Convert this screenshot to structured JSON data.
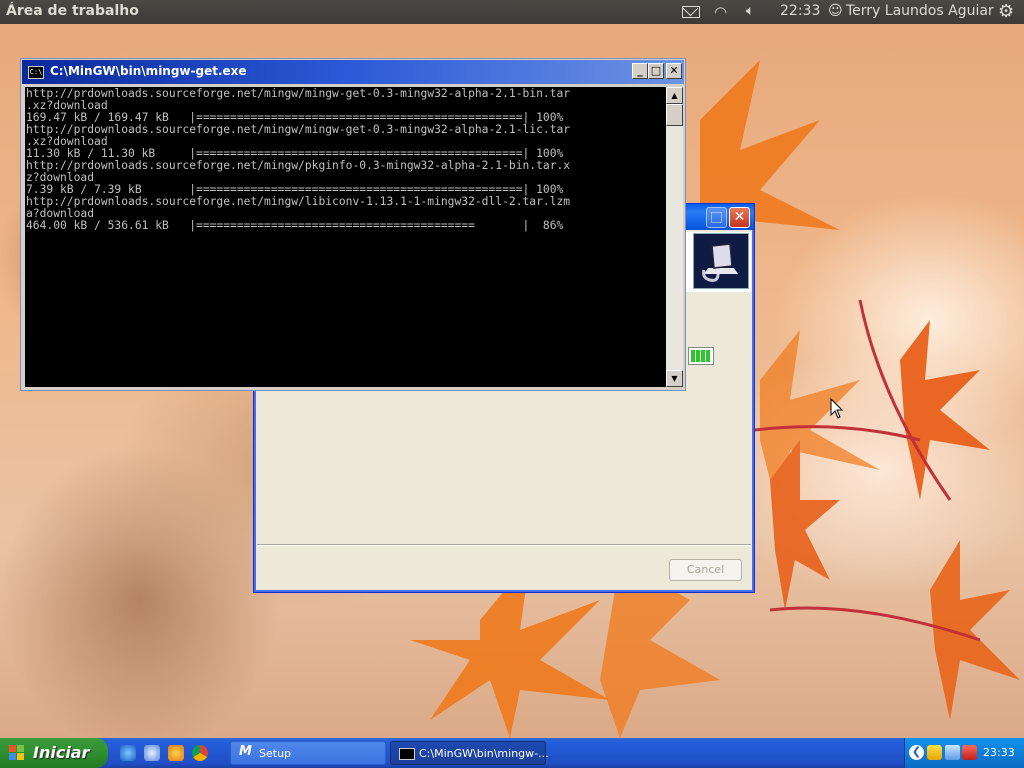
{
  "topbar": {
    "title": "Área de trabalho",
    "clock": "22:33",
    "user": "Terry Laundos Aguiar",
    "icons": [
      "mail-icon",
      "wifi-icon",
      "volume-icon",
      "user-icon",
      "gear-icon"
    ]
  },
  "console": {
    "title": "C:\\MinGW\\bin\\mingw-get.exe",
    "lines": [
      "http://prdownloads.sourceforge.net/mingw/mingw-get-0.3-mingw32-alpha-2.1-bin.tar",
      ".xz?download",
      "169.47 kB / 169.47 kB   |================================================| 100%",
      "http://prdownloads.sourceforge.net/mingw/mingw-get-0.3-mingw32-alpha-2.1-lic.tar",
      ".xz?download",
      "11.30 kB / 11.30 kB     |================================================| 100%",
      "http://prdownloads.sourceforge.net/mingw/pkginfo-0.3-mingw32-alpha-2.1-bin.tar.x",
      "z?download",
      "7.39 kB / 7.39 kB       |================================================| 100%",
      "http://prdownloads.sourceforge.net/mingw/libiconv-1.13.1-1-mingw32-dll-2.tar.lzm",
      "a?download",
      "464.00 kB / 536.61 kB   |=========================================       |  86%"
    ]
  },
  "setup": {
    "cancel_label": "Cancel"
  },
  "taskbar": {
    "start_label": "Iniciar",
    "tasks": [
      {
        "label": "Setup"
      },
      {
        "label": "C:\\MinGW\\bin\\mingw-..."
      }
    ],
    "clock": "23:33"
  }
}
